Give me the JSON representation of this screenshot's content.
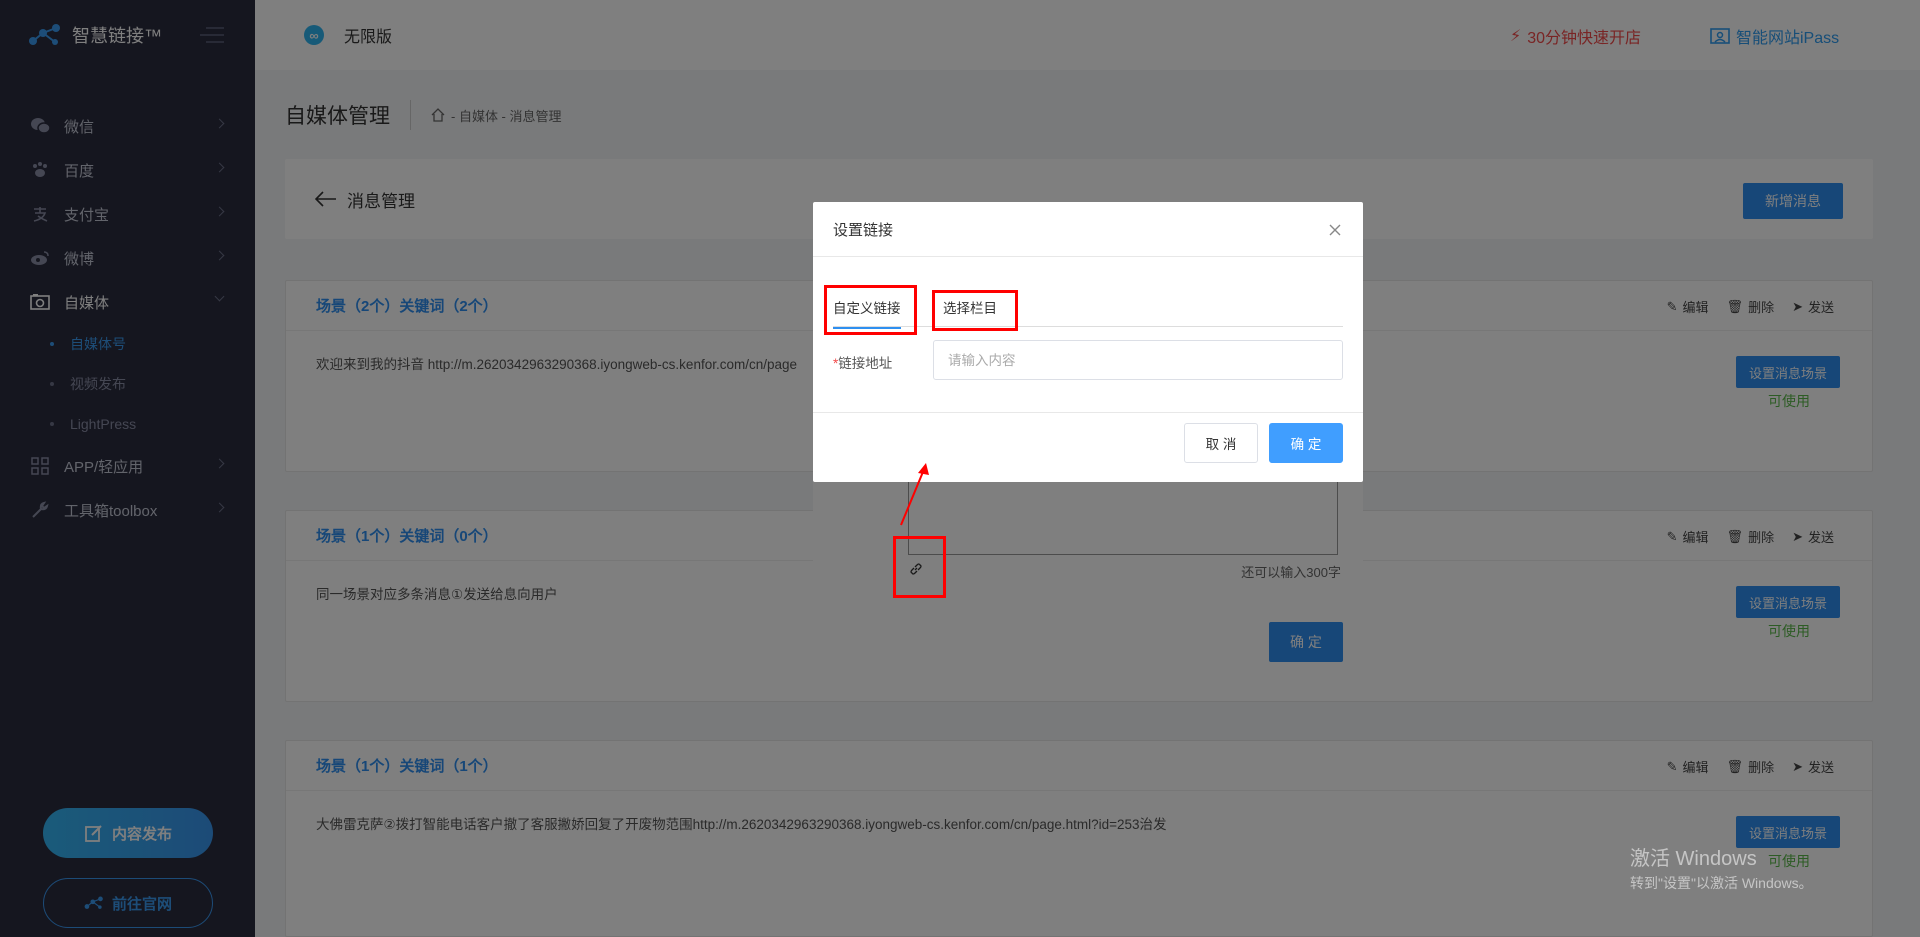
{
  "brand": {
    "name": "智慧链接™"
  },
  "topbar": {
    "version": "无限版",
    "quick_open": "30分钟快速开店",
    "ipass": "智能网站iPass"
  },
  "sidebar": {
    "items": [
      {
        "label": "微信",
        "icon": "wechat-icon"
      },
      {
        "label": "百度",
        "icon": "baidu-paw-icon"
      },
      {
        "label": "支付宝",
        "icon": "alipay-icon"
      },
      {
        "label": "微博",
        "icon": "weibo-icon"
      },
      {
        "label": "自媒体",
        "icon": "camera-icon",
        "active": true
      },
      {
        "label": "APP/轻应用",
        "icon": "grid-icon"
      },
      {
        "label": "工具箱toolbox",
        "icon": "wrench-icon"
      }
    ],
    "sub_items": [
      {
        "label": "自媒体号",
        "active": true
      },
      {
        "label": "视频发布"
      },
      {
        "label": "LightPress"
      }
    ],
    "publish_button": "内容发布",
    "official_site_button": "前往官网"
  },
  "page": {
    "title": "自媒体管理",
    "breadcrumb": "- 自媒体 - 消息管理",
    "back_label": "消息管理",
    "new_message_button": "新增消息"
  },
  "messages": [
    {
      "header": "场景（2个）关键词（2个）",
      "content": "欢迎来到我的抖音 http://m.2620342963290368.iyongweb-cs.kenfor.com/cn/page",
      "status": "可使用"
    },
    {
      "header": "场景（1个）关键词（0个）",
      "content": "同一场景对应多条消息①发送给息向用户",
      "status": "可使用"
    },
    {
      "header": "场景（1个）关键词（1个）",
      "content": "大佛雷克萨②拨打智能电话客户撤了客服撇娇回复了开废物范围http://m.2620342963290368.iyongweb-cs.kenfor.com/cn/page.html?id=253治发",
      "status": "可使用"
    }
  ],
  "message_actions": {
    "edit": "编辑",
    "delete": "删除",
    "send": "发送",
    "set_scene": "设置消息场景"
  },
  "background_dialog": {
    "char_count": "还可以输入300字",
    "confirm": "确 定"
  },
  "modal": {
    "title": "设置链接",
    "tab_custom": "自定义链接",
    "tab_column": "选择栏目",
    "field_label": "链接地址",
    "required_mark": "*",
    "placeholder": "请输入内容",
    "value": "",
    "cancel": "取 消",
    "confirm": "确 定"
  },
  "watermark": {
    "line1": "激活 Windows",
    "line2": "转到\"设置\"以激活 Windows。"
  }
}
